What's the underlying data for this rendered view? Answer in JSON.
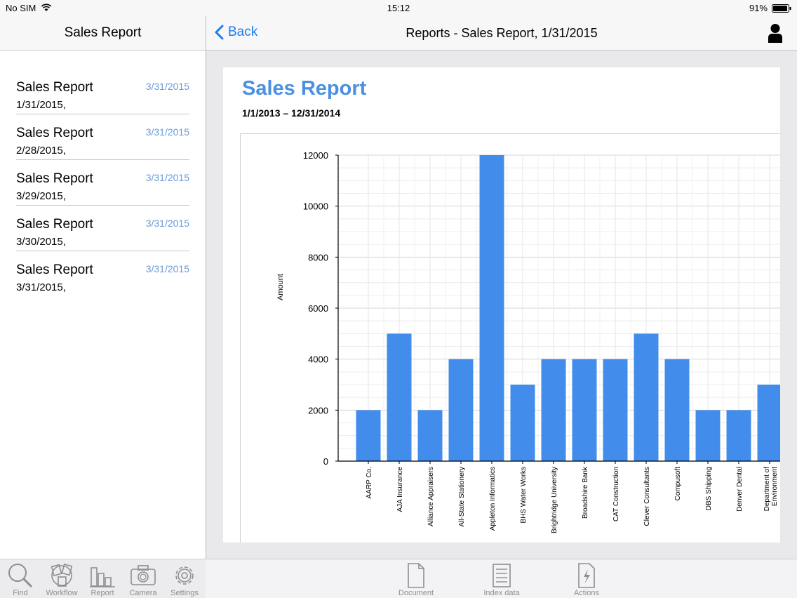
{
  "status_bar": {
    "carrier": "No SIM",
    "time": "15:12",
    "battery": "91%"
  },
  "left_pane": {
    "title": "Sales Report",
    "items": [
      {
        "title": "Sales Report",
        "subtitle": "1/31/2015,",
        "date": "3/31/2015"
      },
      {
        "title": "Sales Report",
        "subtitle": "2/28/2015,",
        "date": "3/31/2015"
      },
      {
        "title": "Sales Report",
        "subtitle": "3/29/2015,",
        "date": "3/31/2015"
      },
      {
        "title": "Sales Report",
        "subtitle": "3/30/2015,",
        "date": "3/31/2015"
      },
      {
        "title": "Sales Report",
        "subtitle": "3/31/2015,",
        "date": "3/31/2015"
      }
    ]
  },
  "right_nav": {
    "back_label": "Back",
    "title": "Reports - Sales Report, 1/31/2015"
  },
  "document": {
    "title": "Sales Report",
    "date_range": "1/1/2013 – 12/31/2014"
  },
  "chart_data": {
    "type": "bar",
    "ylabel": "Amount",
    "xlabel": "",
    "ylim": [
      0,
      12000
    ],
    "yticks": [
      0,
      2000,
      4000,
      6000,
      8000,
      10000,
      12000
    ],
    "grid": true,
    "bar_color": "#428ceb",
    "categories": [
      "AARP Co.",
      "AJA Insurance",
      "Alliance Appraisers",
      "All-State Stationery",
      "Appleton Informatics",
      "BHS Water Works",
      "Brightridge University",
      "Broadshire Bank",
      "CAT Construction",
      "Clever Consultants",
      "Compusoft",
      "DBS Shipping",
      "Denver Dental",
      "Department of Environment"
    ],
    "values": [
      2000,
      5000,
      2000,
      4000,
      12000,
      3000,
      4000,
      4000,
      4000,
      5000,
      4000,
      2000,
      2000,
      3000
    ]
  },
  "toolbar": {
    "left": [
      {
        "label": "Find",
        "icon": "search-icon"
      },
      {
        "label": "Workflow",
        "icon": "workflow-icon"
      },
      {
        "label": "Report",
        "icon": "report-icon"
      },
      {
        "label": "Camera",
        "icon": "camera-icon"
      },
      {
        "label": "Settings",
        "icon": "gear-icon"
      }
    ],
    "right": [
      {
        "label": "Document",
        "icon": "document-icon"
      },
      {
        "label": "Index data",
        "icon": "index-data-icon"
      },
      {
        "label": "Actions",
        "icon": "actions-icon"
      }
    ]
  },
  "colors": {
    "accent": "#1a7cf2",
    "title_blue": "#4a90e2",
    "list_date": "#6a9bd8",
    "toolbar_icon": "#8e8e93"
  }
}
